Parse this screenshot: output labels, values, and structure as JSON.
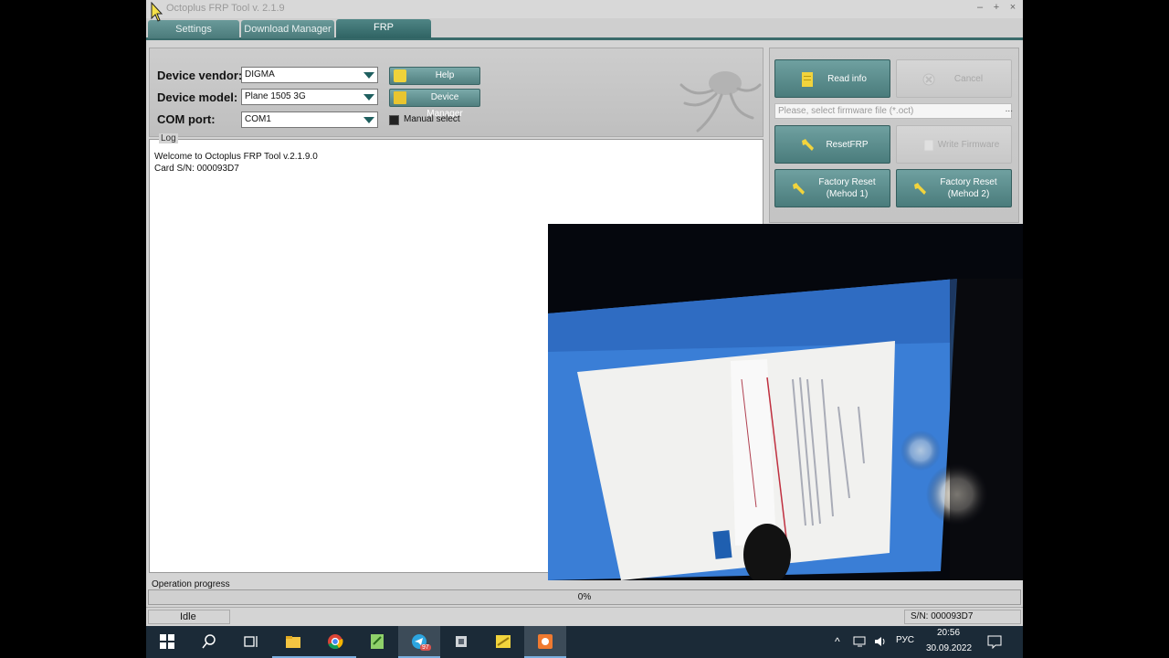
{
  "window": {
    "title": "Octoplus FRP Tool v. 2.1.9",
    "controls": [
      "–",
      "+",
      "×"
    ]
  },
  "tabs": [
    {
      "label": "Settings",
      "active": false
    },
    {
      "label": "Download Manager",
      "active": false
    },
    {
      "label": "FRP",
      "active": true
    }
  ],
  "form": {
    "vendor_label": "Device vendor:",
    "vendor_value": "DIGMA",
    "model_label": "Device model:",
    "model_value": "Plane 1505 3G",
    "port_label": "COM port:",
    "port_value": "COM1",
    "help_label": "Help",
    "device_manager_label": "Device Manager",
    "manual_select_label": "Manual select"
  },
  "actions": {
    "read_info": "Read info",
    "cancel": "Cancel",
    "firmware_placeholder": "Please, select firmware file (*.oct)",
    "browse": "...",
    "reset_frp": "ResetFRP",
    "write_firmware": "Write Firmware",
    "factory_reset_1": "Factory Reset\n(Mehod 1)",
    "factory_reset_2": "Factory Reset\n(Mehod 2)"
  },
  "log": {
    "caption": "Log",
    "lines": [
      "Welcome to Octoplus FRP Tool v.2.1.9.0",
      "Card S/N: 000093D7"
    ]
  },
  "progress": {
    "caption": "Operation progress",
    "value": 0,
    "text": "0%"
  },
  "status": {
    "state": "Idle",
    "serial": "S/N: 000093D7"
  },
  "taskbar": {
    "telegram_badge": "97",
    "lang": "РУС",
    "time": "20:56",
    "date": "30.09.2022"
  },
  "colors": {
    "accent": "#4a7c7c",
    "tab_active": "#2f6363",
    "taskbar": "#1b2a37"
  }
}
